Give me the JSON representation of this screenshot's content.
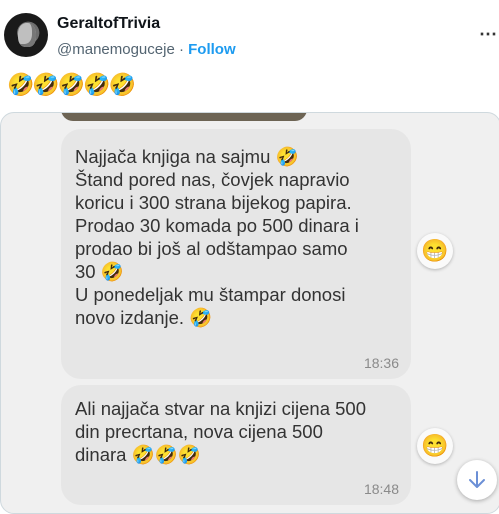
{
  "tweet": {
    "display_name": "GeraltofTrivia",
    "handle": "@manemoguceje",
    "separator": "·",
    "follow_label": "Follow",
    "more_icon": "more-options-icon",
    "text": "🤣🤣🤣🤣🤣"
  },
  "chat": {
    "messages": [
      {
        "text": "Najjača knjiga na sajmu 🤣\nŠtand pored nas, čovjek napravio\nkoricu i 300 strana bijekog papira.\nProdao 30 komada po 500 dinara i\nprodao bi još al odštampao samo\n30 🤣\nU ponedeljak mu štampar donosi\nnovo izdanje. 🤣",
        "time": "18:36",
        "reaction": "😁"
      },
      {
        "text": "Ali najjača stvar na knjizi cijena 500\ndin precrtana, nova cijena 500\ndinara 🤣🤣🤣",
        "time": "18:48",
        "reaction": "😁"
      }
    ],
    "scroll_down_icon": "arrow-down-icon"
  },
  "colors": {
    "follow": "#1d9bf0",
    "bubble": "#e6e6e6",
    "chat_background": "#f0f0f0"
  }
}
